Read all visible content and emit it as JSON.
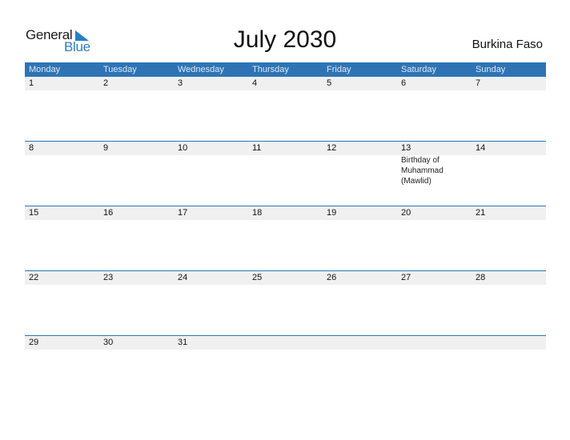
{
  "logo": {
    "text_general": "General",
    "text_blue": "Blue"
  },
  "title": "July 2030",
  "country": "Burkina Faso",
  "weekdays": [
    "Monday",
    "Tuesday",
    "Wednesday",
    "Thursday",
    "Friday",
    "Saturday",
    "Sunday"
  ],
  "weeks": [
    {
      "days": [
        "1",
        "2",
        "3",
        "4",
        "5",
        "6",
        "7"
      ],
      "events": [
        "",
        "",
        "",
        "",
        "",
        "",
        ""
      ]
    },
    {
      "days": [
        "8",
        "9",
        "10",
        "11",
        "12",
        "13",
        "14"
      ],
      "events": [
        "",
        "",
        "",
        "",
        "",
        "Birthday of Muhammad (Mawlid)",
        ""
      ]
    },
    {
      "days": [
        "15",
        "16",
        "17",
        "18",
        "19",
        "20",
        "21"
      ],
      "events": [
        "",
        "",
        "",
        "",
        "",
        "",
        ""
      ]
    },
    {
      "days": [
        "22",
        "23",
        "24",
        "25",
        "26",
        "27",
        "28"
      ],
      "events": [
        "",
        "",
        "",
        "",
        "",
        "",
        ""
      ]
    },
    {
      "days": [
        "29",
        "30",
        "31",
        "",
        "",
        "",
        ""
      ],
      "events": [
        "",
        "",
        "",
        "",
        "",
        "",
        ""
      ]
    }
  ],
  "colors": {
    "header_bg": "#2e74b5",
    "date_bar_bg": "#f0f0f0",
    "brand_blue": "#2a7fc1"
  }
}
